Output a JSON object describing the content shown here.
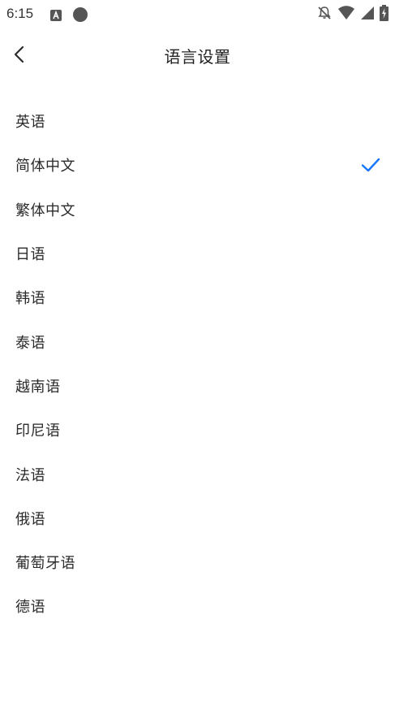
{
  "status_bar": {
    "time": "6:15",
    "icons": [
      "app-a-icon",
      "circle-icon",
      "notifications-off-icon",
      "wifi-icon",
      "signal-icon",
      "battery-charging-icon"
    ]
  },
  "header": {
    "title": "语言设置",
    "back_icon": "chevron-left-icon"
  },
  "languages": [
    {
      "label": "英语",
      "selected": false
    },
    {
      "label": "简体中文",
      "selected": true
    },
    {
      "label": "繁体中文",
      "selected": false
    },
    {
      "label": "日语",
      "selected": false
    },
    {
      "label": "韩语",
      "selected": false
    },
    {
      "label": "泰语",
      "selected": false
    },
    {
      "label": "越南语",
      "selected": false
    },
    {
      "label": "印尼语",
      "selected": false
    },
    {
      "label": "法语",
      "selected": false
    },
    {
      "label": "俄语",
      "selected": false
    },
    {
      "label": "葡萄牙语",
      "selected": false
    },
    {
      "label": "德语",
      "selected": false
    }
  ],
  "colors": {
    "accent": "#1677ff",
    "text": "#2b2b2b",
    "background": "#ffffff"
  }
}
